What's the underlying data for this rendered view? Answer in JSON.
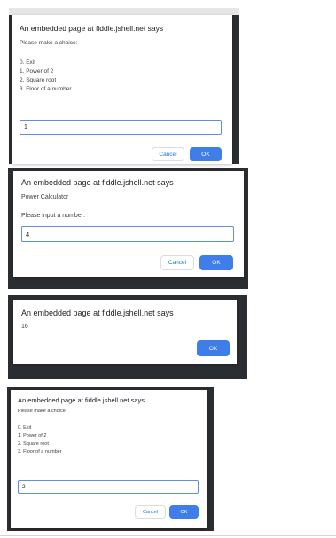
{
  "dialogs": [
    {
      "title": "An embedded page at fiddle.jshell.net says",
      "message_lines": [
        "Please make a choice:",
        "",
        "0. Exit",
        "1. Power of 2",
        "2. Square root",
        "3. Floor of a number"
      ],
      "input_value": "1",
      "cancel_label": "Cancel",
      "ok_label": "OK"
    },
    {
      "title": "An embedded page at fiddle.jshell.net says",
      "message_lines": [
        "Power Calculator",
        "",
        "Please input a number:"
      ],
      "input_value": "4",
      "cancel_label": "Cancel",
      "ok_label": "OK"
    },
    {
      "title": "An embedded page at fiddle.jshell.net says",
      "message_lines": [
        "16"
      ],
      "ok_label": "OK"
    },
    {
      "title": "An embedded page at fiddle.jshell.net says",
      "message_lines": [
        "Please make a choice:",
        "",
        "0. Exit",
        "1. Power of 2",
        "2. Square root",
        "3. Floor of a number"
      ],
      "input_value": "2",
      "cancel_label": "Cancel",
      "ok_label": "OK"
    }
  ],
  "colors": {
    "frame": "#2a2d31",
    "dialog_background": "#ffffff",
    "ok_button": "#3f7de8",
    "input_border": "#5f8fdd"
  }
}
